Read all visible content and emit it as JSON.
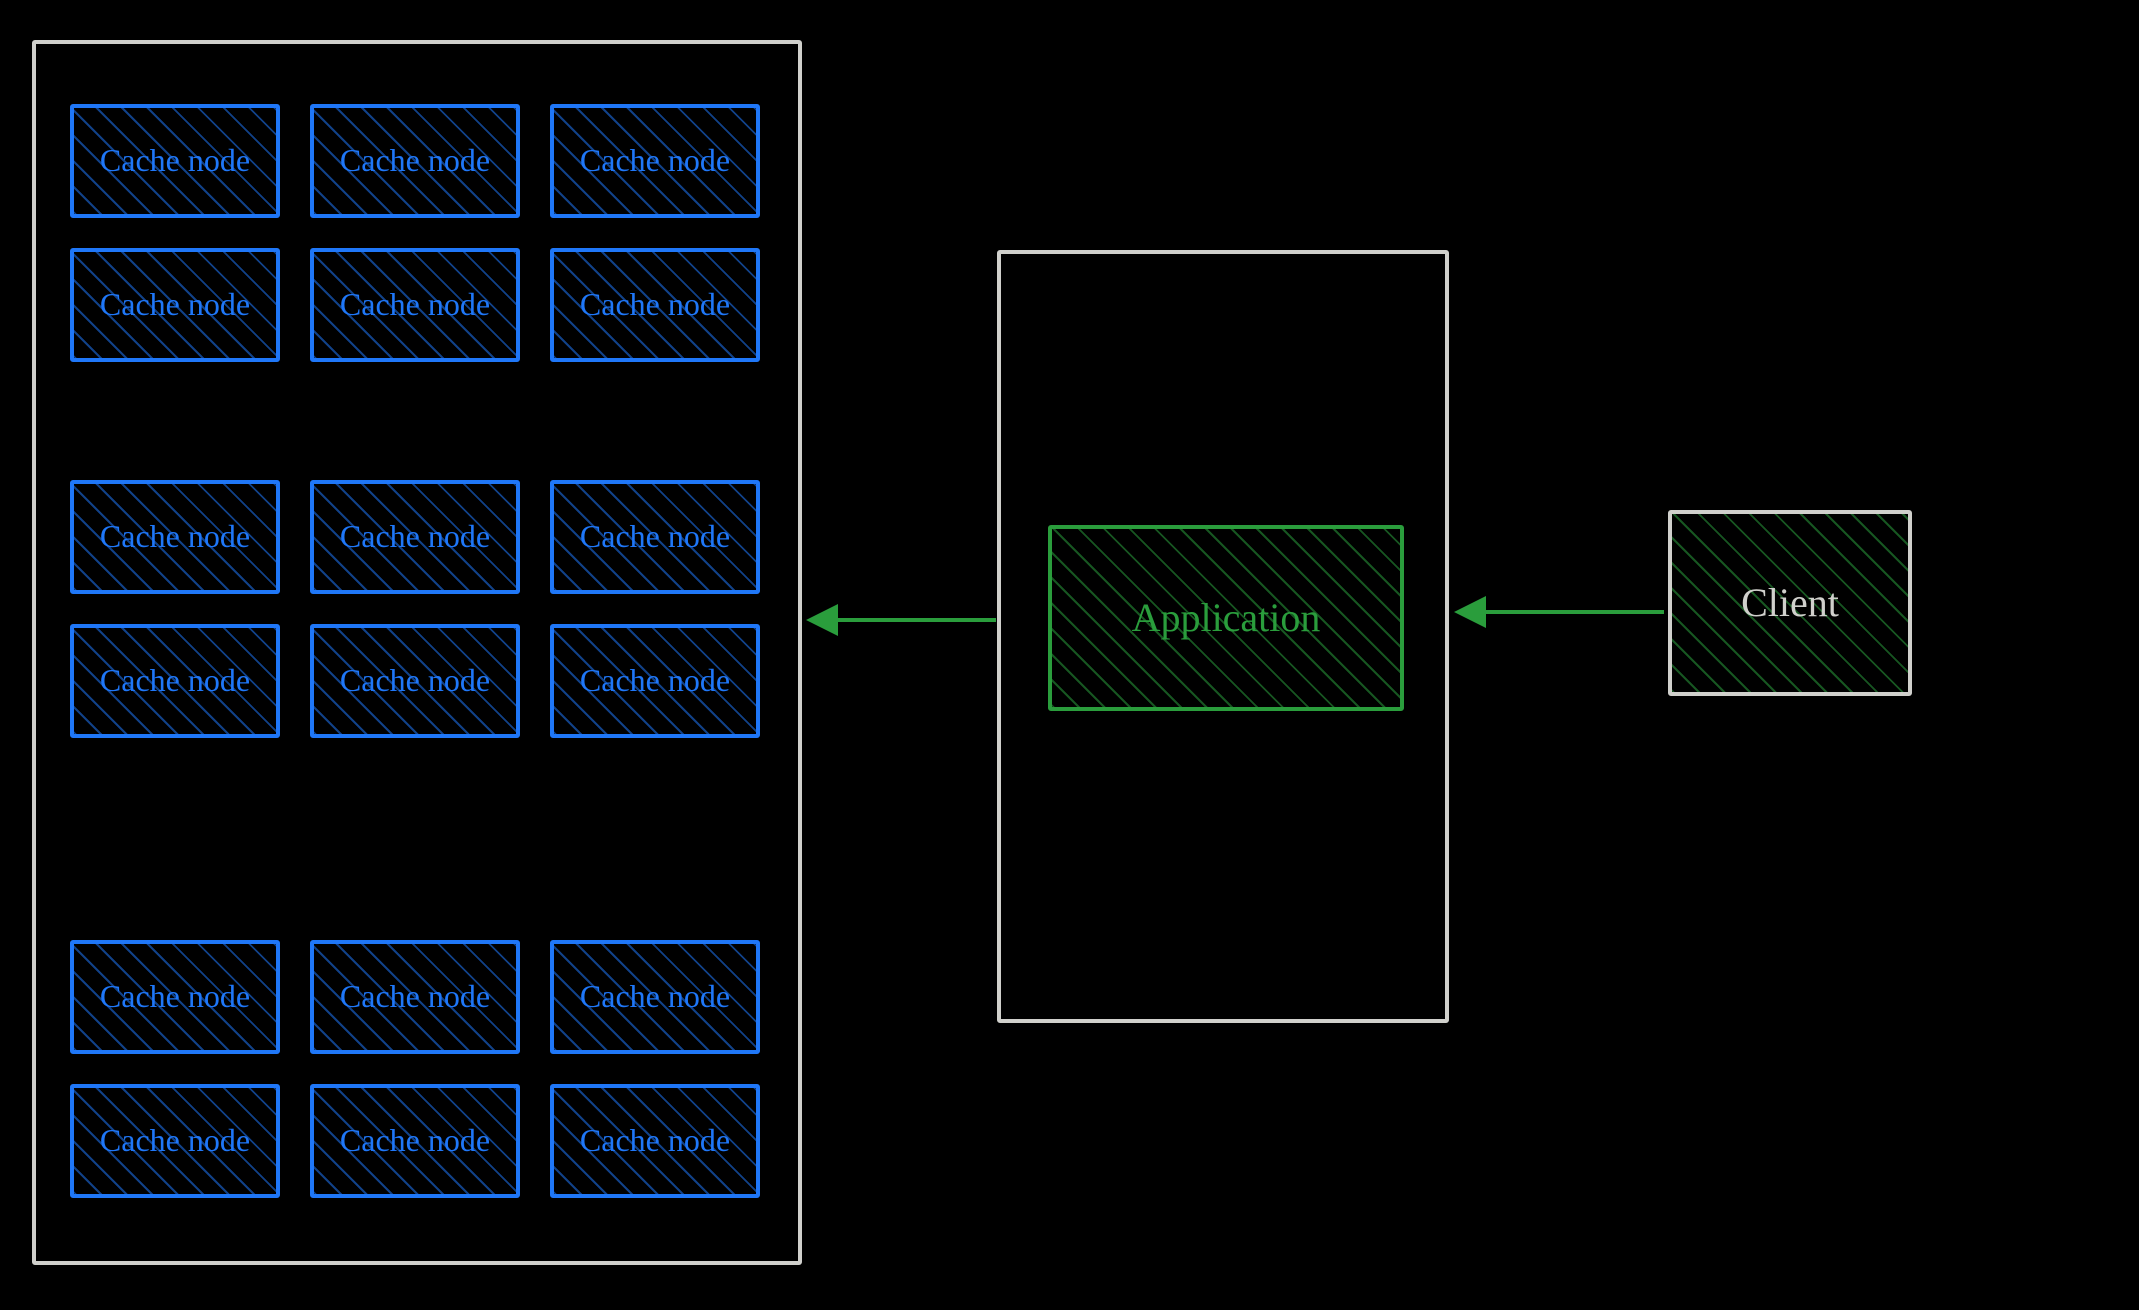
{
  "diagram": {
    "cache_cluster": {
      "label": "Cache node",
      "nodes_per_row": 3,
      "rows": 6,
      "total_nodes": 18
    },
    "application": {
      "label": "Application"
    },
    "client": {
      "label": "Client"
    },
    "arrows": [
      {
        "from": "client",
        "to": "application-container",
        "color": "#2a9d3c"
      },
      {
        "from": "application-container",
        "to": "cache-cluster",
        "color": "#2a9d3c"
      }
    ],
    "colors": {
      "cache": "#1f77f8",
      "app_border": "#2a9d3c",
      "frame": "#d0d0cc",
      "arrow": "#2a9d3c",
      "background": "#000000"
    }
  }
}
